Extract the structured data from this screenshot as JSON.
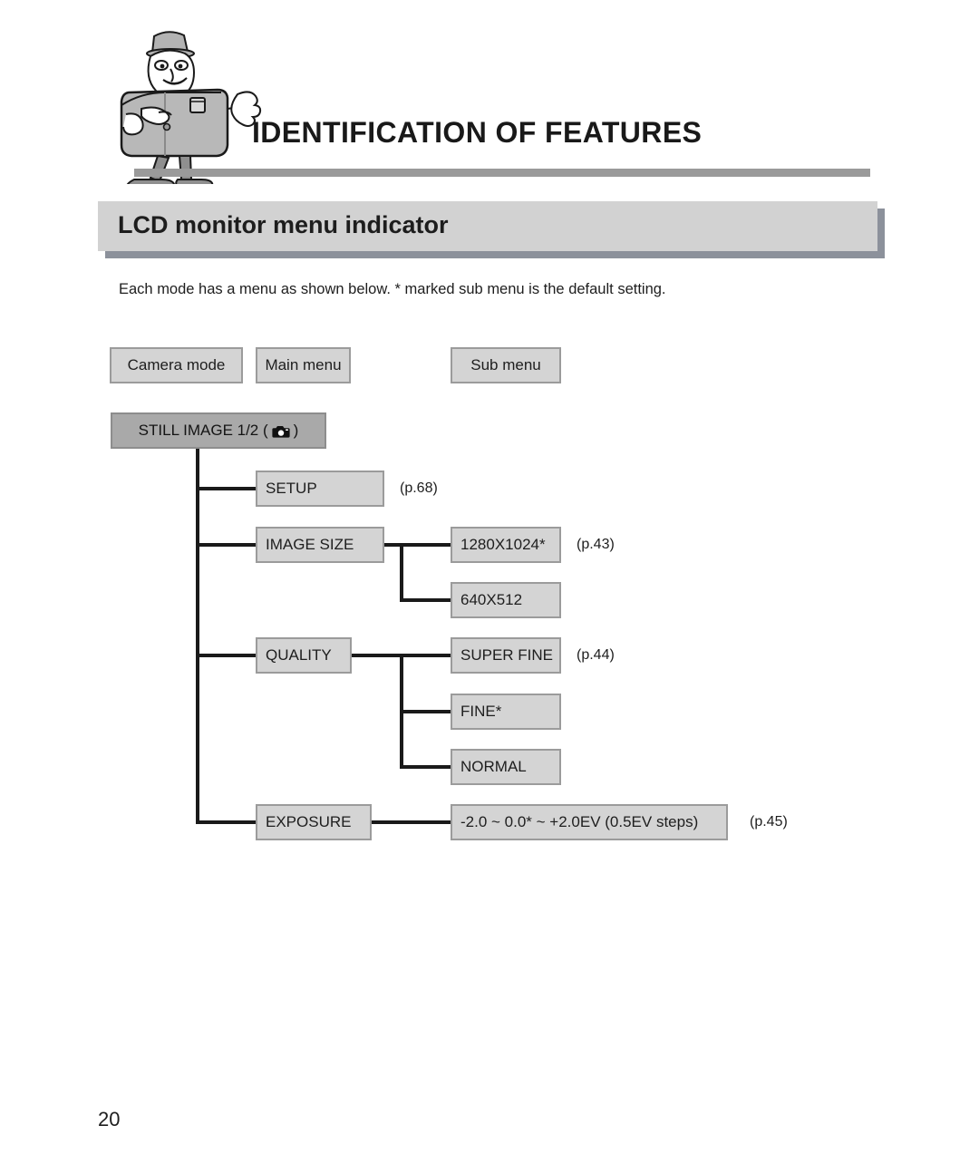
{
  "header": {
    "title": "IDENTIFICATION OF FEATURES",
    "mascot_icon": "camera-mascot-icon"
  },
  "section": {
    "title": "LCD monitor menu indicator"
  },
  "intro": {
    "text": "Each mode has a menu as shown below. * marked sub menu is the default setting."
  },
  "columns": [
    {
      "label": "Camera mode"
    },
    {
      "label": "Main menu"
    },
    {
      "label": "Sub menu"
    }
  ],
  "mode": {
    "label": "STILL IMAGE 1/2 (",
    "label_close": ")",
    "icon": "camera-icon"
  },
  "menu": [
    {
      "label": "SETUP",
      "pageref": "(p.68)",
      "submenu": []
    },
    {
      "label": "IMAGE SIZE",
      "pageref": "(p.43)",
      "submenu": [
        {
          "label": "1280X1024*"
        },
        {
          "label": "640X512"
        }
      ]
    },
    {
      "label": "QUALITY",
      "pageref": "(p.44)",
      "submenu": [
        {
          "label": "SUPER FINE"
        },
        {
          "label": "FINE*"
        },
        {
          "label": "NORMAL"
        }
      ]
    },
    {
      "label": "EXPOSURE",
      "pageref": "(p.45)",
      "submenu": [
        {
          "label": "-2.0 ~ 0.0* ~ +2.0EV (0.5EV steps)"
        }
      ]
    }
  ],
  "footer": {
    "page_number": "20"
  },
  "colors": {
    "box_fill": "#d4d4d4",
    "box_border": "#9b9b9b",
    "mode_fill": "#a9a9a9",
    "rule": "#9a9a9a",
    "titlebar_fill": "#d2d2d2",
    "titlebar_shadow": "#8c919b",
    "line": "#1a1a1a"
  }
}
